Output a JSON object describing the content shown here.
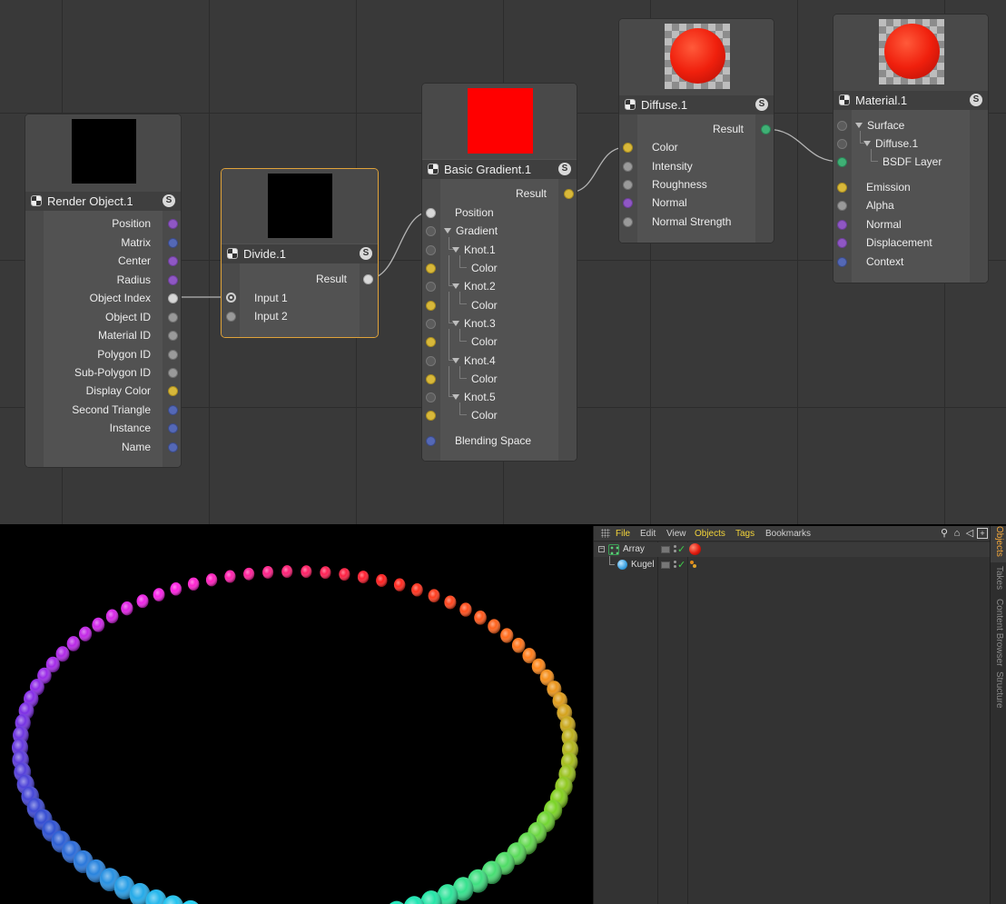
{
  "nodes": {
    "render_object": {
      "title": "Render Object.1",
      "badge": "S",
      "outputs": [
        "Position",
        "Matrix",
        "Center",
        "Radius",
        "Object Index",
        "Object ID",
        "Material ID",
        "Polygon ID",
        "Sub-Polygon ID",
        "Display Color",
        "Second Triangle",
        "Instance",
        "Name"
      ],
      "preview_color": "#000000"
    },
    "divide": {
      "title": "Divide.1",
      "badge": "S",
      "output": "Result",
      "inputs": [
        "Input 1",
        "Input 2"
      ],
      "preview_color": "#000000"
    },
    "basic_gradient": {
      "title": "Basic Gradient.1",
      "badge": "S",
      "output": "Result",
      "position": "Position",
      "gradient": "Gradient",
      "knots": [
        {
          "label": "Knot.1",
          "color": "Color"
        },
        {
          "label": "Knot.2",
          "color": "Color"
        },
        {
          "label": "Knot.3",
          "color": "Color"
        },
        {
          "label": "Knot.4",
          "color": "Color"
        },
        {
          "label": "Knot.5",
          "color": "Color"
        }
      ],
      "blending": "Blending Space",
      "preview_color": "#ff0000"
    },
    "diffuse": {
      "title": "Diffuse.1",
      "badge": "S",
      "output": "Result",
      "inputs": [
        "Color",
        "Intensity",
        "Roughness",
        "Normal",
        "Normal Strength"
      ]
    },
    "material": {
      "title": "Material.1",
      "badge": "S",
      "surface": "Surface",
      "diffuse": "Diffuse.1",
      "bsdf": "BSDF Layer",
      "inputs": [
        "Emission",
        "Alpha",
        "Normal",
        "Displacement",
        "Context"
      ]
    }
  },
  "object_manager": {
    "menus": [
      "File",
      "Edit",
      "View",
      "Objects",
      "Tags",
      "Bookmarks"
    ],
    "objects": [
      {
        "name": "Array",
        "icon": "array-icon"
      },
      {
        "name": "Kugel",
        "icon": "sphere-icon"
      }
    ],
    "side_tabs": [
      "Objects",
      "Takes",
      "Content Browser",
      "Structure"
    ]
  },
  "viewport": {
    "sphere_count": 90,
    "colors": [
      "#ff1f1f",
      "#ff8a1a",
      "#7ed21f",
      "#1ee6b0",
      "#1fdcf6",
      "#2f4fd0",
      "#8a2be8",
      "#ff22e6"
    ]
  }
}
